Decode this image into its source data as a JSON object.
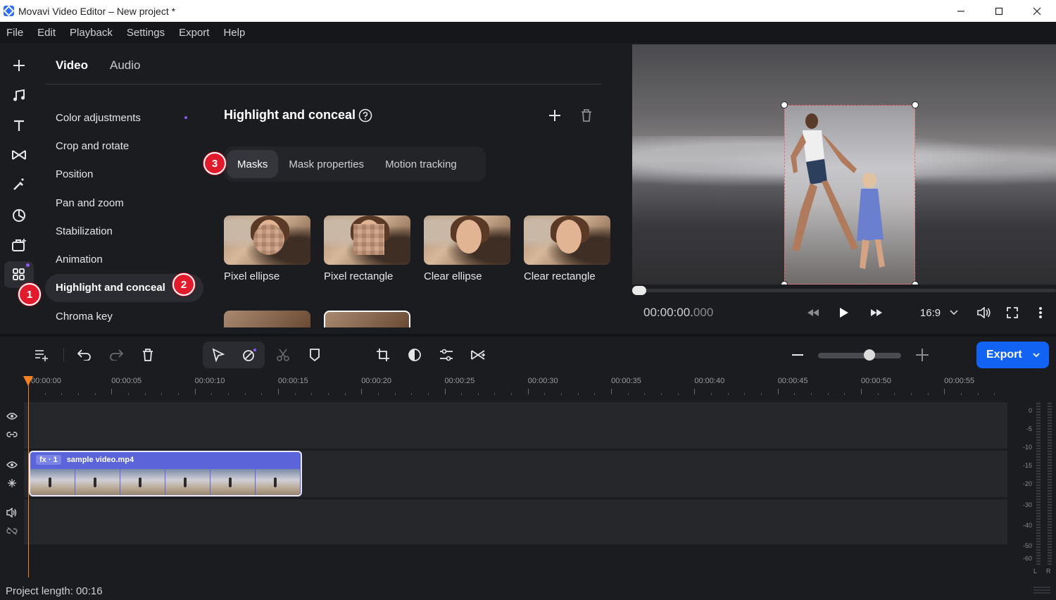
{
  "window": {
    "title": "Movavi Video Editor – New project *"
  },
  "menu": [
    "File",
    "Edit",
    "Playback",
    "Settings",
    "Export",
    "Help"
  ],
  "panel": {
    "tabs": [
      "Video",
      "Audio"
    ],
    "categories": [
      "Color adjustments",
      "Crop and rotate",
      "Position",
      "Pan and zoom",
      "Stabilization",
      "Animation",
      "Highlight and conceal",
      "Chroma key"
    ],
    "active_category": "Highlight and conceal",
    "section_title": "Highlight and conceal",
    "subtabs": [
      "Masks",
      "Mask properties",
      "Motion tracking"
    ],
    "presets": [
      "Pixel ellipse",
      "Pixel rectangle",
      "Clear ellipse",
      "Clear rectangle"
    ]
  },
  "badges": [
    "1",
    "2",
    "3"
  ],
  "preview": {
    "timecode_main": "00:00:00.",
    "timecode_ms": "000",
    "aspect": "16:9"
  },
  "toolbar": {
    "export_label": "Export"
  },
  "timeline": {
    "ruler": [
      "00:00:00",
      "00:00:05",
      "00:00:10",
      "00:00:15",
      "00:00:20",
      "00:00:25",
      "00:00:30",
      "00:00:35",
      "00:00:40",
      "00:00:45",
      "00:00:50",
      "00:00:55"
    ],
    "clip": {
      "fx_label": "fx · 1",
      "name": "sample video.mp4"
    },
    "meter_labels": [
      "0",
      "-5",
      "-10",
      "-15",
      "-20",
      "-30",
      "-40",
      "-50",
      "-60"
    ],
    "meter_channels": [
      "L",
      "R"
    ]
  },
  "status": {
    "project_length": "Project length: 00:16"
  },
  "colors": {
    "accent": "#1262f4",
    "badge": "#e21b2c",
    "playhead": "#f58220",
    "clip": "#5b64d8"
  }
}
